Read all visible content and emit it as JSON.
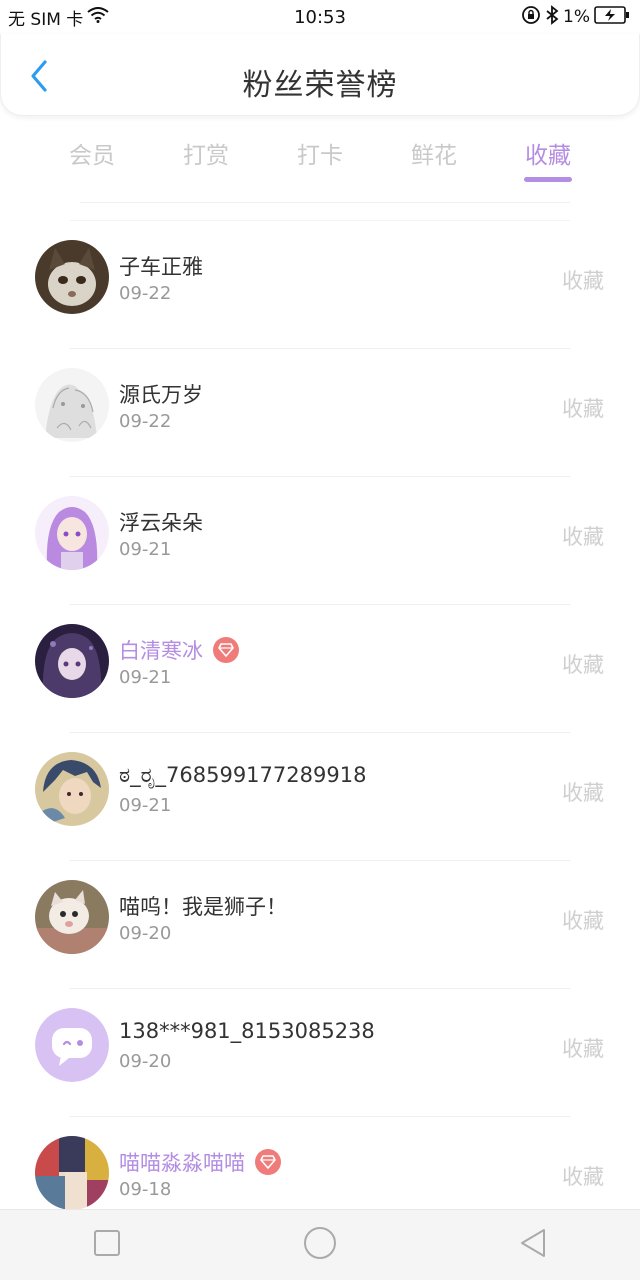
{
  "status_bar": {
    "carrier": "无 SIM 卡",
    "time": "10:53",
    "battery": "1%",
    "icons": [
      "wifi-icon",
      "rotation-lock-icon",
      "bluetooth-icon",
      "battery-charging-icon"
    ]
  },
  "header": {
    "title": "粉丝荣誉榜",
    "back_icon": "chevron-left-icon"
  },
  "tabs": [
    {
      "label": "会员",
      "active": false
    },
    {
      "label": "打赏",
      "active": false
    },
    {
      "label": "打卡",
      "active": false
    },
    {
      "label": "鲜花",
      "active": false
    },
    {
      "label": "收藏",
      "active": true
    }
  ],
  "list": [
    {
      "name": "子车正雅",
      "date": "09-22",
      "action": "收藏",
      "vip": false,
      "avatar": "cat-photo"
    },
    {
      "name": "源氏万岁",
      "date": "09-22",
      "action": "收藏",
      "vip": false,
      "avatar": "sketch-drawing"
    },
    {
      "name": "浮云朵朵",
      "date": "09-21",
      "action": "收藏",
      "vip": false,
      "avatar": "purple-hair-anime-girl"
    },
    {
      "name": "白清寒冰",
      "date": "09-21",
      "action": "收藏",
      "vip": true,
      "avatar": "dark-anime-girl"
    },
    {
      "name": "ಠ_ರೃ_768599177289918",
      "date": "09-21",
      "action": "收藏",
      "vip": false,
      "avatar": "anime-boy"
    },
    {
      "name": "喵呜！我是狮子！",
      "date": "09-20",
      "action": "收藏",
      "vip": false,
      "avatar": "cat-photo-2"
    },
    {
      "name": "138***981_8153085238",
      "date": "09-20",
      "action": "收藏",
      "vip": false,
      "avatar": "default-chat-avatar"
    },
    {
      "name": "喵喵淼淼喵喵",
      "date": "09-18",
      "action": "收藏",
      "vip": true,
      "avatar": "colorful-anime-collage"
    }
  ],
  "colors": {
    "accent": "#b48ee2",
    "vip_badge": "#f07b7b",
    "inactive_tab": "#c9c9c9",
    "back_arrow": "#2e9cf0"
  },
  "nav_bar": {
    "buttons": [
      "square-icon",
      "circle-icon",
      "triangle-back-icon"
    ]
  }
}
